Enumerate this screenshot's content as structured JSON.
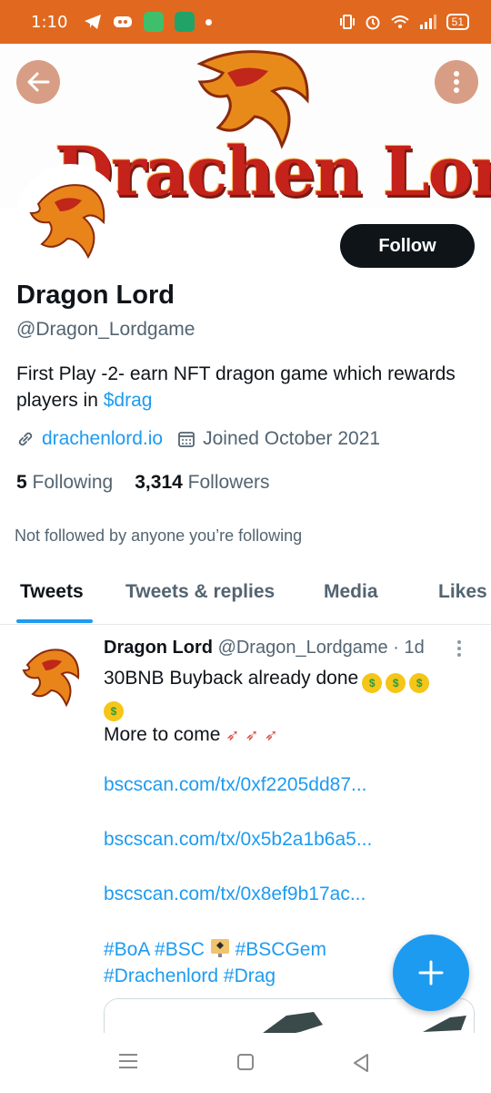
{
  "status_bar": {
    "time": "1:10",
    "battery": "51"
  },
  "banner": {
    "title": "Drachen Lord"
  },
  "profile": {
    "follow_label": "Follow",
    "name": "Dragon Lord",
    "handle": "@Dragon_Lordgame",
    "bio_text": "First Play -2- earn NFT dragon game which rewards players in ",
    "bio_cashtag": "$drag",
    "website": "drachenlord.io",
    "joined": "Joined October 2021",
    "following_count": "5",
    "following_label": "Following",
    "followers_count": "3,314",
    "followers_label": "Followers",
    "not_followed": "Not followed by anyone you’re following"
  },
  "tabs": [
    {
      "label": "Tweets",
      "active": true
    },
    {
      "label": "Tweets & replies",
      "active": false
    },
    {
      "label": "Media",
      "active": false
    },
    {
      "label": "Likes",
      "active": false
    }
  ],
  "tweet": {
    "author_name": "Dragon Lord",
    "author_handle": "@Dragon_Lordgame",
    "separator": "·",
    "age": "1d",
    "line1": "30BNB Buyback already done",
    "line2": "More to come",
    "links": [
      "bscscan.com/tx/0xf2205dd87...",
      "bscscan.com/tx/0x5b2a1b6a5...",
      "bscscan.com/tx/0x8ef9b17ac..."
    ],
    "hashtags_line1a": "#BoA #BSC",
    "hashtags_line1b": "#BSCGem",
    "hashtags_line2": "#Drachenlord #Drag"
  },
  "icons": {
    "back": "back-arrow-icon",
    "more": "more-vertical-icon",
    "link": "link-icon",
    "calendar": "calendar-icon",
    "compose": "plus-icon"
  },
  "colors": {
    "status_bar": "#e0691f",
    "accent": "#1d9bf0",
    "text": "#0f1419",
    "secondary": "#536471"
  }
}
